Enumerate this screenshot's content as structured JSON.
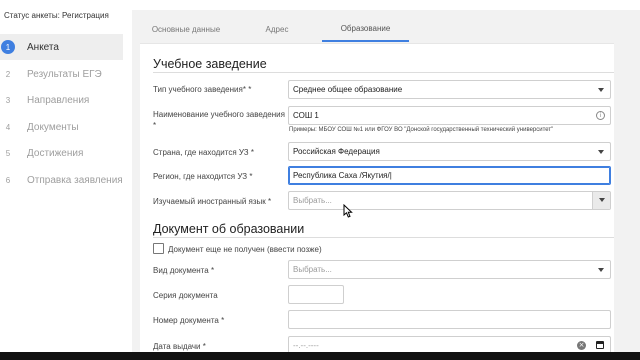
{
  "sidebar": {
    "status_title": "Статус анкеты: Регистрация",
    "steps": [
      {
        "num": "1",
        "label": "Анкета"
      },
      {
        "num": "2",
        "label": "Результаты ЕГЭ"
      },
      {
        "num": "3",
        "label": "Направления"
      },
      {
        "num": "4",
        "label": "Документы"
      },
      {
        "num": "5",
        "label": "Достижения"
      },
      {
        "num": "6",
        "label": "Отправка заявления"
      }
    ]
  },
  "tabs": [
    "Основные данные",
    "Адрес",
    "Образование"
  ],
  "institution": {
    "section_title": "Учебное заведение",
    "type_label": "Тип учебного заведения*",
    "type_value": "Среднее общее образование",
    "name_label_line1": "Наименование учебного заведения",
    "name_value": "СОШ 1",
    "name_hint": "Примеры: МБОУ СОШ №1 или ФГОУ ВО \"Донской государственный технический университет\"",
    "country_label": "Страна, где находится УЗ",
    "country_value": "Российская Федерация",
    "region_label": "Регион, где находится УЗ",
    "region_value": "Республика Саха /Якутия/",
    "language_label": "Изучаемый иностранный язык",
    "language_placeholder": "Выбрать..."
  },
  "document": {
    "section_title": "Документ об образовании",
    "not_received_label": "Документ еще не получен (ввести позже)",
    "type_label": "Вид документа",
    "type_placeholder": "Выбрать...",
    "series_label": "Серия документа",
    "number_label": "Номер документа",
    "date_label": "Дата выдачи",
    "date_placeholder": "--.--.----"
  },
  "common": {
    "required_mark": "*",
    "info_glyph": "i",
    "clear_glyph": "×"
  },
  "icons": {
    "cursor": "mouse-pointer-icon"
  },
  "colors": {
    "accent": "#3f7fe0"
  }
}
